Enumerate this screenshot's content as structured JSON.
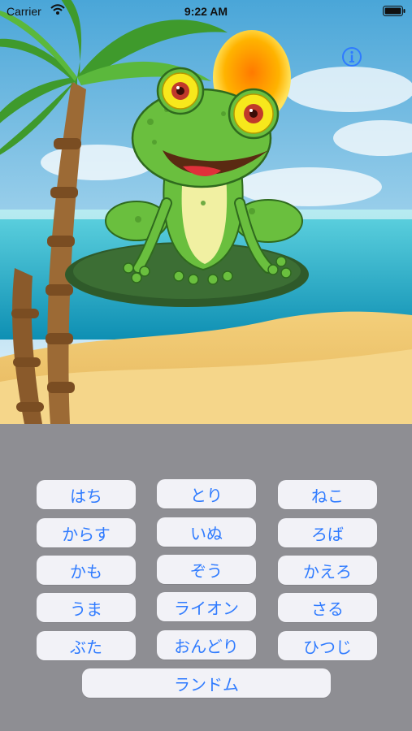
{
  "status_bar": {
    "carrier": "Carrier",
    "time": "9:22 AM"
  },
  "buttons": [
    {
      "label": "はち"
    },
    {
      "label": "とり"
    },
    {
      "label": "ねこ"
    },
    {
      "label": "からす"
    },
    {
      "label": "いぬ"
    },
    {
      "label": "ろば"
    },
    {
      "label": "かも"
    },
    {
      "label": "ぞう"
    },
    {
      "label": "かえろ"
    },
    {
      "label": "うま"
    },
    {
      "label": "ライオン"
    },
    {
      "label": "さる"
    },
    {
      "label": "ぶた"
    },
    {
      "label": "おんどり"
    },
    {
      "label": "ひつじ"
    }
  ],
  "random_button": {
    "label": "ランドム"
  },
  "colors": {
    "accent": "#2f7bff",
    "panel": "#8e8e93",
    "button": "#f2f2f7"
  },
  "icons": [
    "wifi-icon",
    "battery-icon",
    "info-icon"
  ]
}
